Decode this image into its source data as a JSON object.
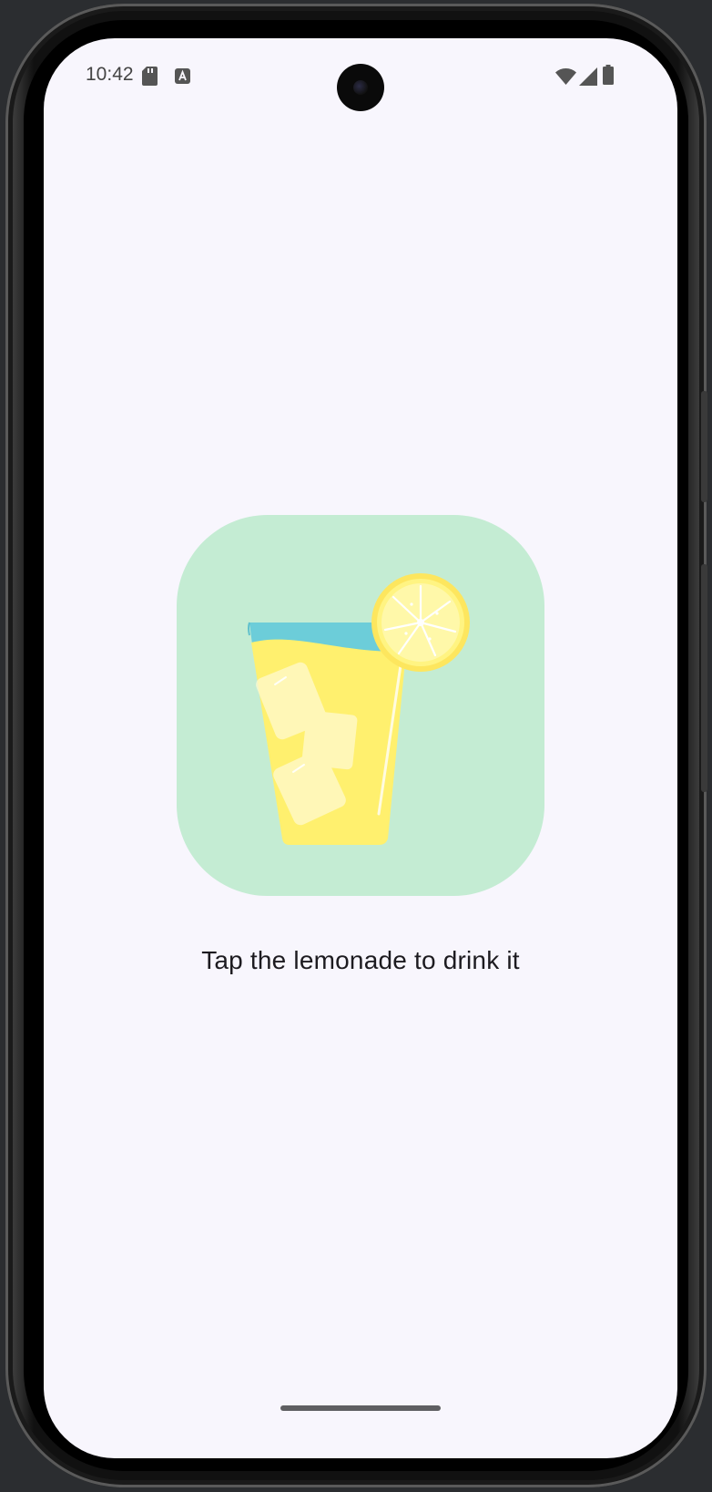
{
  "status_bar": {
    "time": "10:42",
    "left_icons": [
      "sd-card-icon",
      "app-notification-icon"
    ],
    "right_icons": [
      "wifi-icon",
      "cellular-signal-icon",
      "battery-icon"
    ]
  },
  "app": {
    "image_description_icon": "lemonade-glass-icon",
    "instruction_text": "Tap the lemonade to drink it",
    "colors": {
      "screen_background": "#f8f6fd",
      "image_tile_background": "#c4ecd3",
      "lemonade": "#fff06e",
      "lemonade_top": "#6ccdd9",
      "lemon": "#fff06e"
    }
  }
}
